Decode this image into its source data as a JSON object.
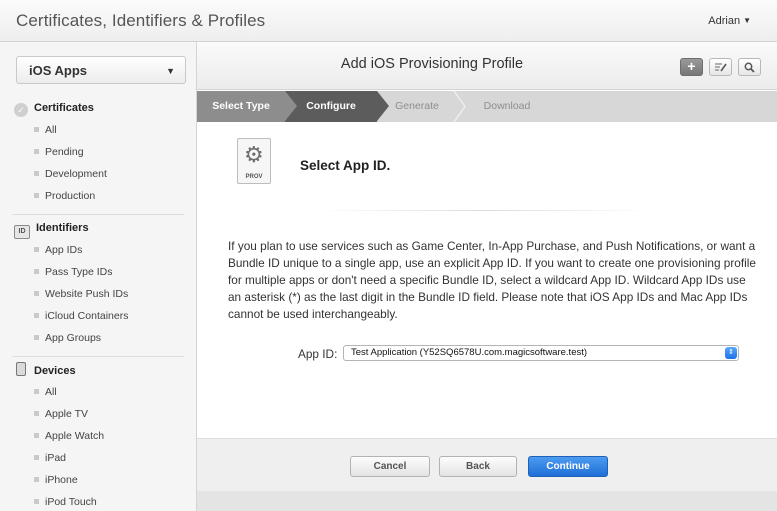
{
  "header": {
    "title": "Certificates, Identifiers & Profiles",
    "user": "Adrian"
  },
  "sidebar": {
    "platform": "iOS Apps",
    "sections": [
      {
        "title": "Certificates",
        "items": [
          "All",
          "Pending",
          "Development",
          "Production"
        ]
      },
      {
        "title": "Identifiers",
        "items": [
          "App IDs",
          "Pass Type IDs",
          "Website Push IDs",
          "iCloud Containers",
          "App Groups"
        ]
      },
      {
        "title": "Devices",
        "items": [
          "All",
          "Apple TV",
          "Apple Watch",
          "iPad",
          "iPhone",
          "iPod Touch"
        ]
      }
    ],
    "id_icon_text": "ID"
  },
  "main": {
    "title": "Add iOS Provisioning Profile",
    "steps": [
      "Select Type",
      "Configure",
      "Generate",
      "Download"
    ],
    "active_step": "Configure",
    "prov_icon_label": "PROV",
    "section_title": "Select App ID.",
    "description": "If you plan to use services such as Game Center, In-App Purchase, and Push Notifications, or want a Bundle ID unique to a single app, use an explicit App ID. If you want to create one provisioning profile for multiple apps or don't need a specific Bundle ID, select a wildcard App ID. Wildcard App IDs use an asterisk (*) as the last digit in the Bundle ID field. Please note that iOS App IDs and Mac App IDs cannot be used interchangeably.",
    "app_id_label": "App ID:",
    "app_id_value": "Test Application (Y52SQ6578U.com.magicsoftware.test)"
  },
  "footer": {
    "cancel": "Cancel",
    "back": "Back",
    "continue": "Continue"
  },
  "icons": [
    "checkmark-badge-icon",
    "id-card-icon",
    "device-icon",
    "plus-icon",
    "edit-icon",
    "search-icon",
    "gear-icon",
    "chevron-down-icon"
  ],
  "colors": {
    "accent": "#1e6ed8",
    "active_step": "#5c5c5c",
    "done_step": "#8d8d8d"
  }
}
